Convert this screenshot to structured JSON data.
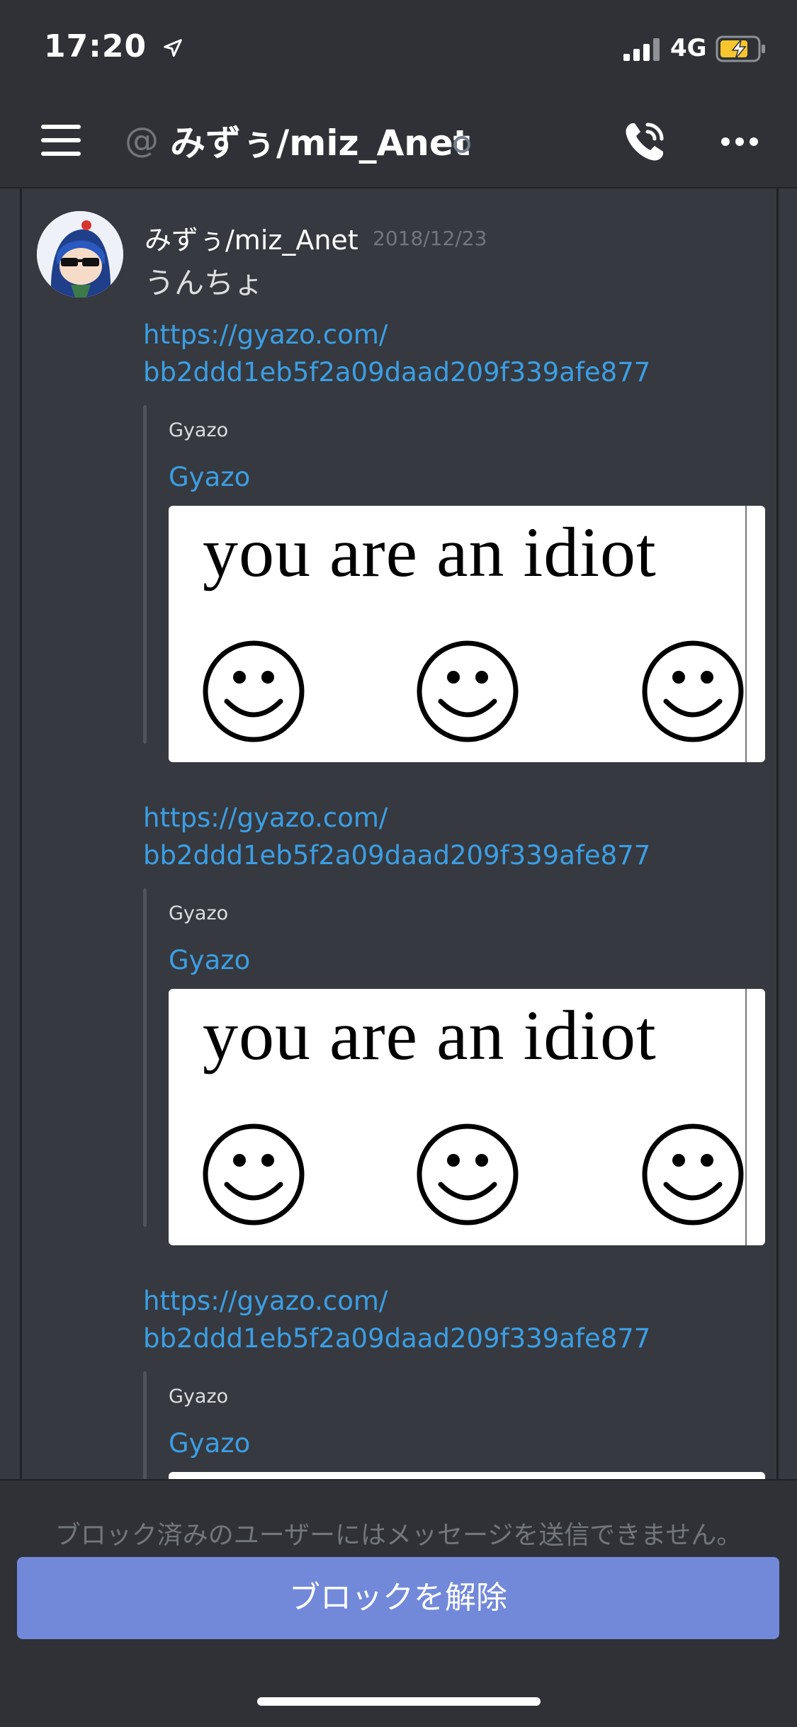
{
  "status_bar": {
    "time": "17:20",
    "network": "4G",
    "location_icon": "location-arrow-icon",
    "signal_icon": "cellular-signal-icon",
    "battery_icon": "battery-charging-icon"
  },
  "header": {
    "at_symbol": "@",
    "title": "みずぅ/miz_Anet",
    "menu_icon": "hamburger-menu-icon",
    "call_icon": "phone-call-icon",
    "more_icon": "more-dots-icon"
  },
  "message": {
    "author": "みずぅ/miz_Anet",
    "timestamp": "2018/12/23",
    "text": "うんちょ",
    "items": [
      {
        "link_line1": "https://gyazo.com/",
        "link_line2": "bb2ddd1eb5f2a09daad209f339afe877",
        "provider": "Gyazo",
        "embed_title": "Gyazo",
        "image_text": "you are an idiot"
      },
      {
        "link_line1": "https://gyazo.com/",
        "link_line2": "bb2ddd1eb5f2a09daad209f339afe877",
        "provider": "Gyazo",
        "embed_title": "Gyazo",
        "image_text": "you are an idiot"
      },
      {
        "link_line1": "https://gyazo.com/",
        "link_line2": "bb2ddd1eb5f2a09daad209f339afe877",
        "provider": "Gyazo",
        "embed_title": "Gyazo"
      }
    ]
  },
  "footer": {
    "blocked_notice": "ブロック済みのユーザーにはメッセージを送信できません。",
    "unblock_label": "ブロックを解除"
  },
  "colors": {
    "background": "#36393f",
    "header": "#2f3136",
    "link": "#3b9fe5",
    "button": "#7289da"
  }
}
